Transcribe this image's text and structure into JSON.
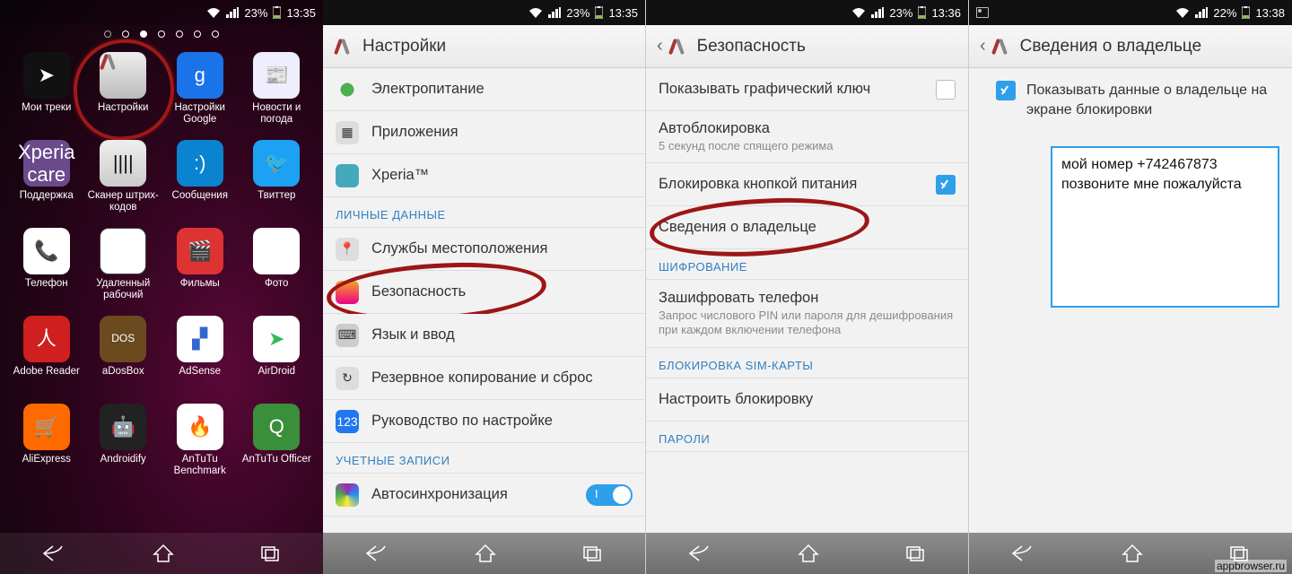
{
  "statusbar": {
    "battery1": "23%",
    "time1": "13:35",
    "battery2": "23%",
    "time2": "13:35",
    "battery3": "23%",
    "time3": "13:36",
    "battery4": "22%",
    "time4": "13:38"
  },
  "apps": [
    {
      "label": "Мои треки"
    },
    {
      "label": "Настройки"
    },
    {
      "label": "Настройки Google"
    },
    {
      "label": "Новости и погода"
    },
    {
      "label": "Поддержка"
    },
    {
      "label": "Сканер штрих-кодов"
    },
    {
      "label": "Сообщения"
    },
    {
      "label": "Твиттер"
    },
    {
      "label": "Телефон"
    },
    {
      "label": "Удаленный рабочий"
    },
    {
      "label": "Фильмы"
    },
    {
      "label": "Фото"
    },
    {
      "label": "Adobe Reader"
    },
    {
      "label": "aDosBox"
    },
    {
      "label": "AdSense"
    },
    {
      "label": "AirDroid"
    },
    {
      "label": "AliExpress"
    },
    {
      "label": "Androidify"
    },
    {
      "label": "AnTuTu Benchmark"
    },
    {
      "label": "AnTuTu Officer"
    }
  ],
  "settings": {
    "title": "Настройки",
    "items": {
      "power": "Электропитание",
      "apps": "Приложения",
      "xperia": "Xperia™",
      "section_personal": "ЛИЧНЫЕ ДАННЫЕ",
      "location": "Службы местоположения",
      "security": "Безопасность",
      "lang": "Язык и ввод",
      "backup": "Резервное копирование и сброс",
      "guide": "Руководство по настройке",
      "section_accounts": "УЧЕТНЫЕ ЗАПИСИ",
      "autosync": "Автосинхронизация"
    }
  },
  "security": {
    "title": "Безопасность",
    "pattern": "Показывать графический ключ",
    "autolock": "Автоблокировка",
    "autolock_sub": "5 секунд после спящего режима",
    "powerlock": "Блокировка кнопкой питания",
    "owner": "Сведения о владельце",
    "section_enc": "ШИФРОВАНИЕ",
    "encrypt": "Зашифровать телефон",
    "encrypt_sub": "Запрос числового PIN или пароля для дешифрования при каждом включении телефона",
    "section_sim": "БЛОКИРОВКА SIM-КАРТЫ",
    "simlock": "Настроить блокировку",
    "section_pwd": "ПАРОЛИ"
  },
  "owner": {
    "title": "Сведения о владельце",
    "checkbox_label": "Показывать данные о владельце на экране блокировки",
    "text": "мой номер +742467873 позвоните мне пожалуйста"
  },
  "watermark": "appbrowser.ru"
}
